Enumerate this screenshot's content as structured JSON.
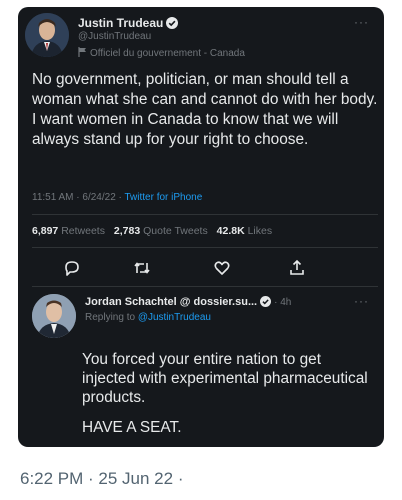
{
  "tweet": {
    "author_name": "Justin Trudeau",
    "handle": "@JustinTrudeau",
    "gov_label": "Officiel du gouvernement - Canada",
    "text": "No government, politician, or man should tell a woman what she can and cannot do with her body.  I want women in Canada to know that we will always stand up for your right to choose.",
    "time": "11:51 AM · 6/24/22 · ",
    "source": "Twitter for iPhone",
    "stats": {
      "retweets_count": "6,897",
      "retweets_label": "Retweets",
      "quotes_count": "2,783",
      "quotes_label": "Quote Tweets",
      "likes_count": "42.8K",
      "likes_label": "Likes"
    },
    "more": "···"
  },
  "reply": {
    "author_name": "Jordan Schachtel @ dossier.su...",
    "age": "· 4h",
    "replying_prefix": "Replying to ",
    "replying_to": "@JustinTrudeau",
    "para1": "You forced your entire nation to get injected with experimental pharmaceutical products.",
    "para2": "HAVE A SEAT.",
    "more": "···"
  },
  "footer": {
    "timestamp": "6:22 PM · 25 Jun 22 ·"
  },
  "colors": {
    "card_bg": "#15181c",
    "text": "#e7e9ea",
    "muted": "#71767b",
    "accent": "#1d9bf0",
    "page_bg": "#ffffff"
  },
  "icons": [
    "verified-badge-icon",
    "flag-icon",
    "reply-icon",
    "retweet-icon",
    "like-icon",
    "share-icon"
  ]
}
